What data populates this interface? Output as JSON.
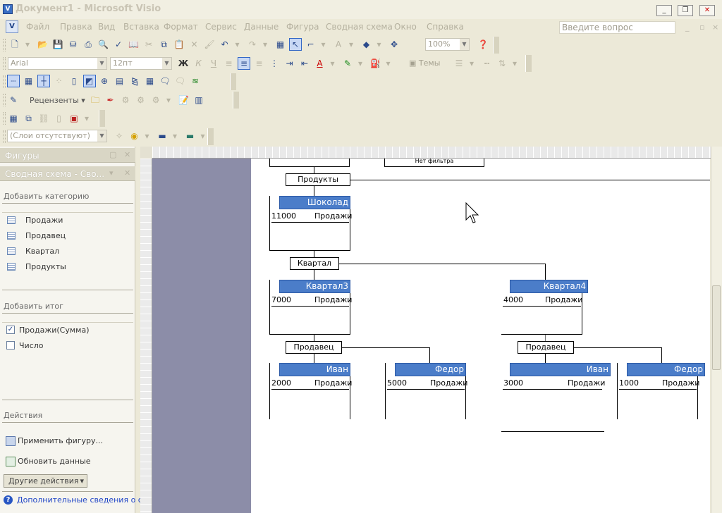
{
  "window": {
    "title": "Документ1 - Microsoft Visio",
    "app_icon": "visio-app-icon",
    "controls": [
      "_",
      "❐",
      "✕"
    ]
  },
  "menu": {
    "items": [
      "Файл",
      "Правка",
      "Вид",
      "Вставка",
      "Формат",
      "Сервис",
      "Данные",
      "Фигура",
      "Сводная схема",
      "Окно",
      "Справка"
    ],
    "help_placeholder": "Введите вопрос",
    "mdi_controls": [
      "_",
      "▫",
      "×"
    ]
  },
  "toolbar_standard": {
    "zoom": "100%"
  },
  "toolbar_format": {
    "font": "Arial",
    "size": "12пт",
    "theme": "Темы"
  },
  "toolbar_reviewing": {
    "reviewers": "Рецензенты"
  },
  "toolbar_layers": {
    "layers": "(Слои отсутствуют)"
  },
  "taskpane": {
    "shapes_title": "Фигуры",
    "pivot_title": "Сводная схема - Сво...",
    "add_category": "Добавить категорию",
    "categories": [
      "Продажи",
      "Продавец",
      "Квартал",
      "Продукты"
    ],
    "add_total": "Добавить итог",
    "totals": [
      {
        "label": "Продажи(Сумма)",
        "checked": true
      },
      {
        "label": "Число",
        "checked": false
      }
    ],
    "actions_title": "Действия",
    "actions": [
      "Применить фигуру...",
      "Обновить данные"
    ],
    "other_actions": "Другие действия",
    "more_info": "Дополнительные сведения о сво"
  },
  "diagram": {
    "filter_text": "Нет фильтра",
    "cat_products": "Продукты",
    "cat_quarter": "Квартал",
    "cat_seller": "Продавец",
    "sales_label": "Продажи",
    "nodes": {
      "chocolate": {
        "title": "Шоколад",
        "value": "11000"
      },
      "q3": {
        "title": "Квартал3",
        "value": "7000"
      },
      "q4": {
        "title": "Квартал4",
        "value": "4000"
      },
      "q3_ivan": {
        "title": "Иван",
        "value": "2000"
      },
      "q3_fedor": {
        "title": "Федор",
        "value": "5000"
      },
      "q4_ivan": {
        "title": "Иван",
        "value": "3000"
      },
      "q4_fedor": {
        "title": "Федор",
        "value": "1000"
      }
    }
  }
}
